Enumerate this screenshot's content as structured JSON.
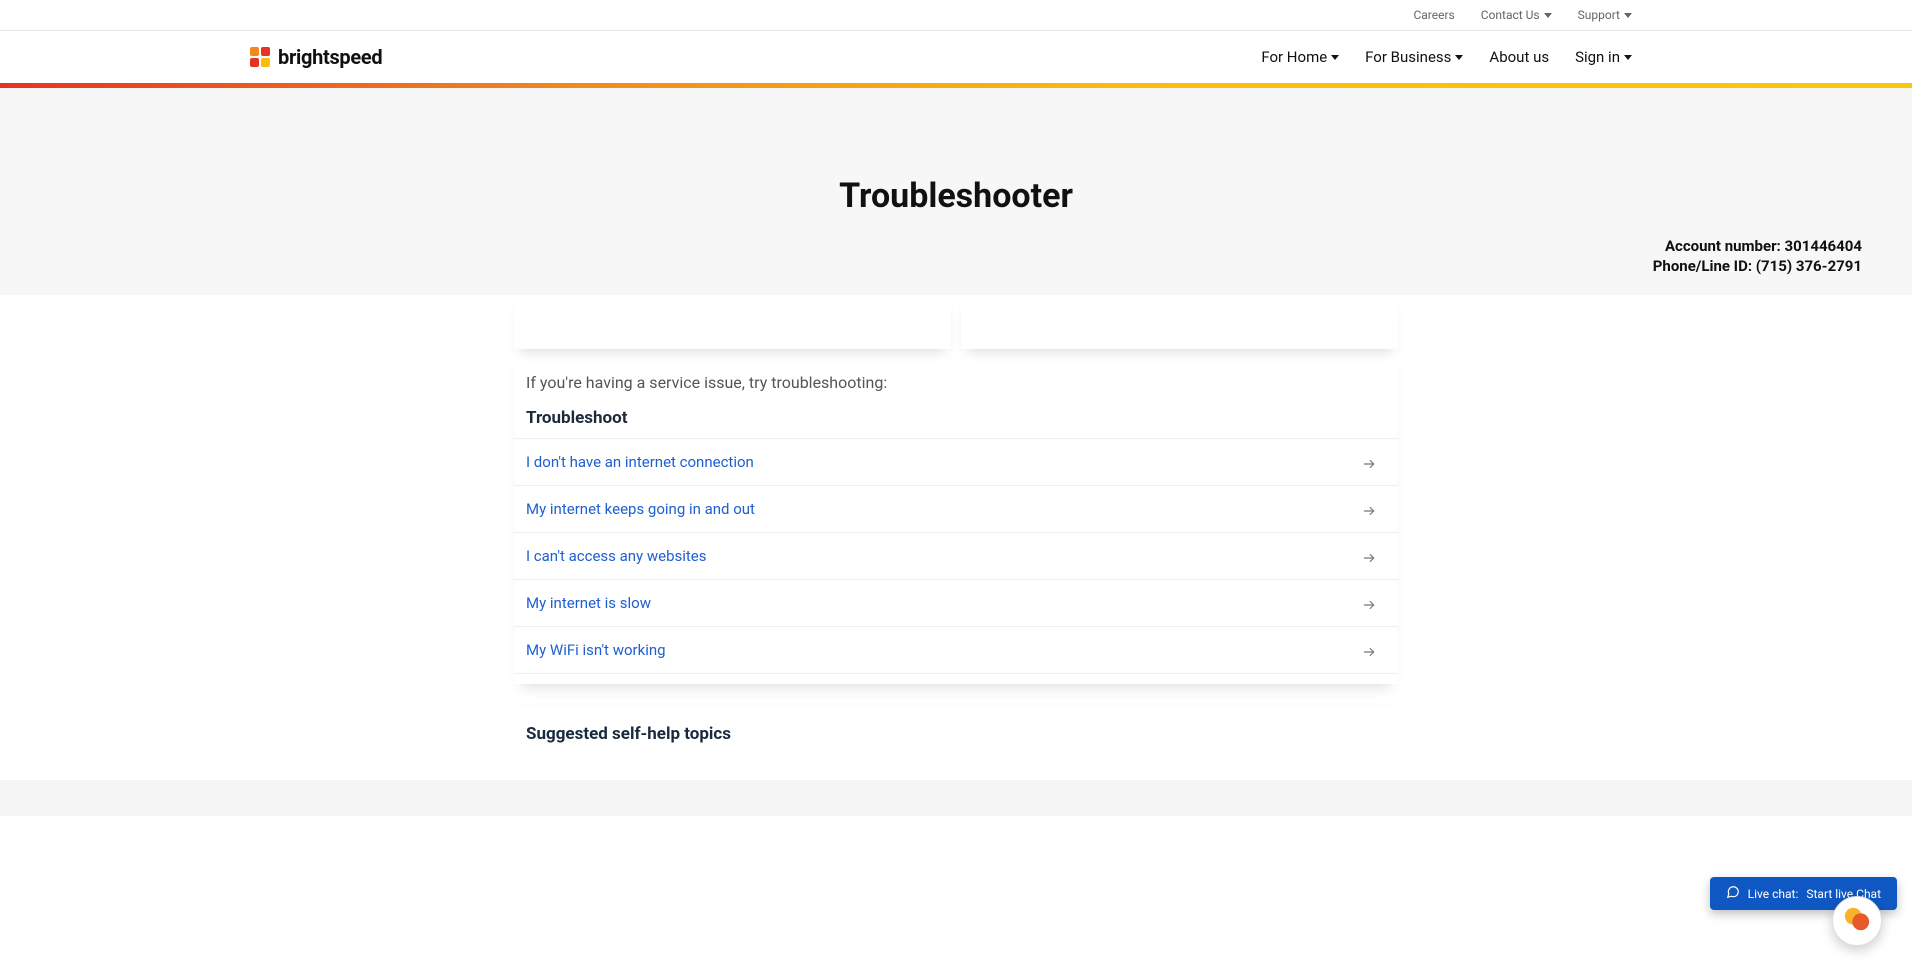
{
  "utility": {
    "careers": "Careers",
    "contact": "Contact Us",
    "support": "Support"
  },
  "brand": {
    "name": "brightspeed"
  },
  "nav": {
    "for_home": "For Home",
    "for_business": "For Business",
    "about_us": "About us",
    "sign_in": "Sign in"
  },
  "hero": {
    "title": "Troubleshooter",
    "account_label": "Account number:",
    "account_value": "301446404",
    "phone_label": "Phone/Line ID:",
    "phone_value": "(715) 376-2791"
  },
  "intro": "If you're having a service issue, try troubleshooting:",
  "ts_header": "Troubleshoot",
  "items": [
    {
      "label": "I don't have an internet connection"
    },
    {
      "label": "My internet keeps going in and out"
    },
    {
      "label": "I can't access any websites"
    },
    {
      "label": "My internet is slow"
    },
    {
      "label": "My WiFi isn't working"
    }
  ],
  "suggested": {
    "header": "Suggested self-help topics"
  },
  "chat": {
    "live_prefix": "Live chat:",
    "start": "Start live Chat"
  }
}
